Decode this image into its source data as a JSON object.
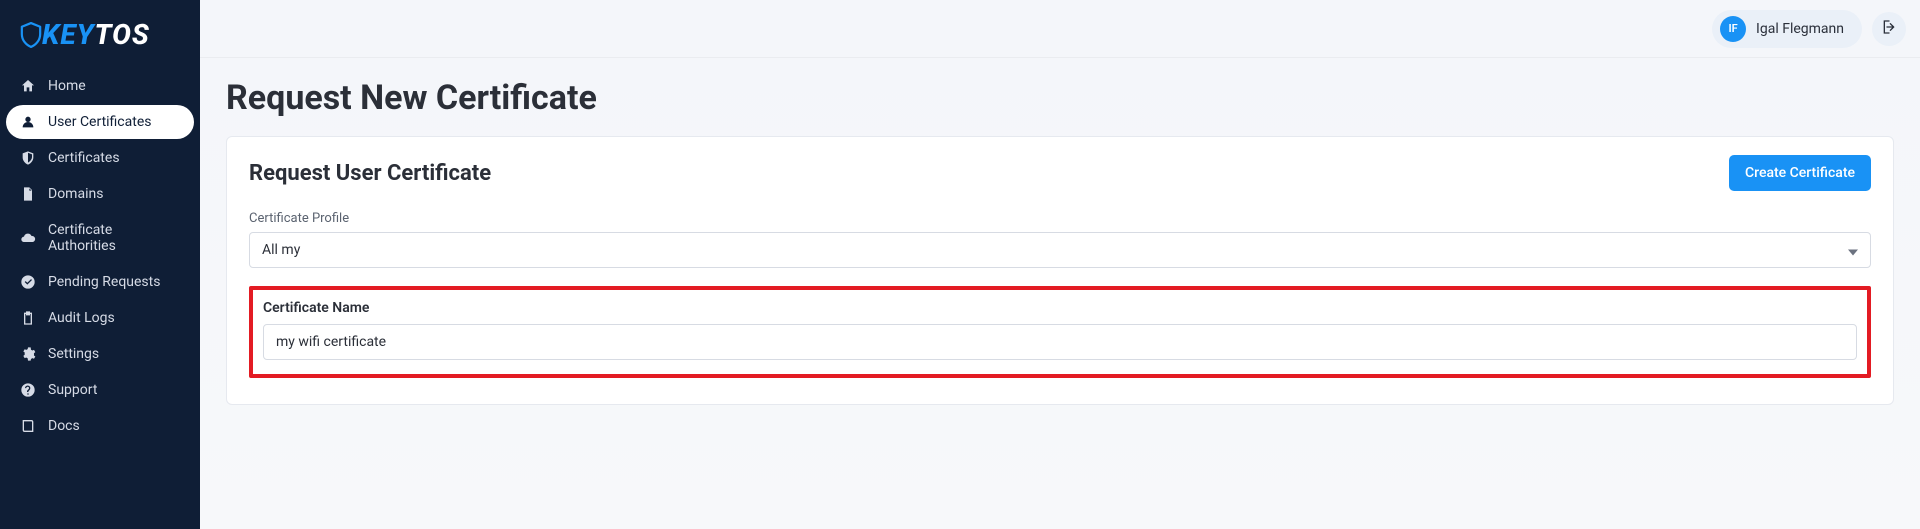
{
  "brand": {
    "pre": "K",
    "mid": "EY",
    "post": "TOS"
  },
  "sidebar": {
    "items": [
      {
        "label": "Home"
      },
      {
        "label": "User Certificates"
      },
      {
        "label": "Certificates"
      },
      {
        "label": "Domains"
      },
      {
        "label": "Certificate Authorities"
      },
      {
        "label": "Pending Requests"
      },
      {
        "label": "Audit Logs"
      },
      {
        "label": "Settings"
      },
      {
        "label": "Support"
      },
      {
        "label": "Docs"
      }
    ]
  },
  "topbar": {
    "avatar_initials": "IF",
    "user_name": "Igal Flegmann"
  },
  "page": {
    "title": "Request New Certificate"
  },
  "card": {
    "title": "Request User Certificate",
    "create_button": "Create Certificate",
    "profile_label": "Certificate Profile",
    "profile_value": "All my",
    "name_label": "Certificate Name",
    "name_value": "my wifi certificate"
  }
}
